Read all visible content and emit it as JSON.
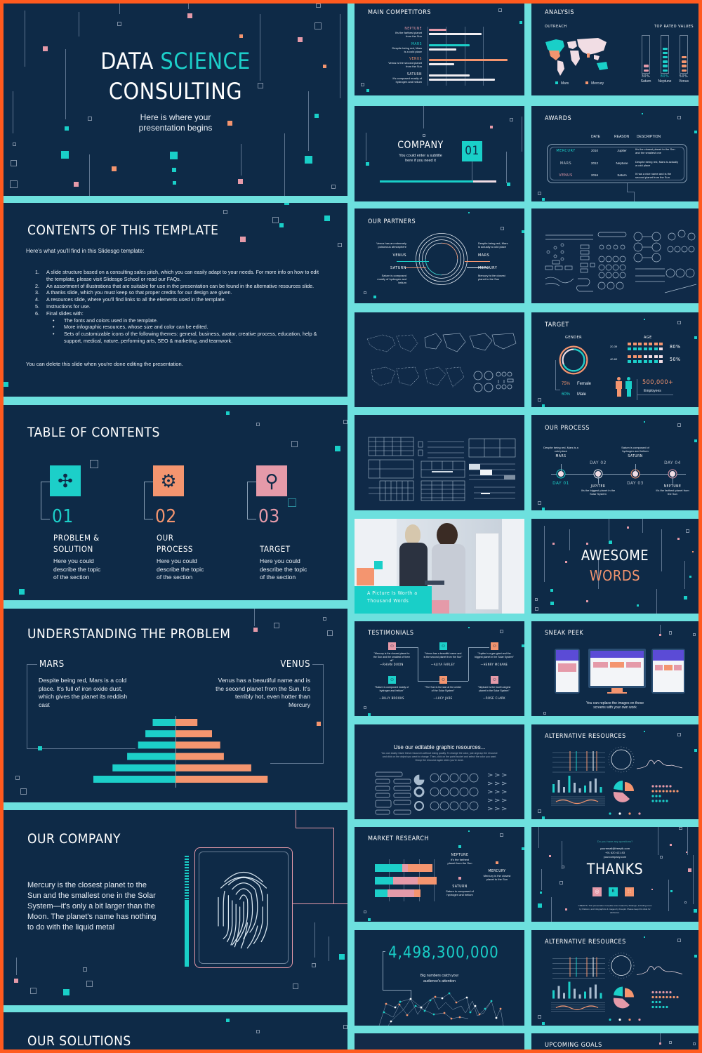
{
  "colors": {
    "border": "#ff5a1f",
    "gap": "#6de0de",
    "background": "#0e2a47",
    "teal": "#1ccfc9",
    "salmon": "#f4956f",
    "pink": "#e59aa9",
    "white": "#ffffff"
  },
  "left_slides": {
    "title": {
      "line1_a": "DATA",
      "line1_b": "SCIENCE",
      "line2": "CONSULTING",
      "subtitle_1": "Here is where your",
      "subtitle_2": "presentation begins"
    },
    "contents": {
      "title": "CONTENTS OF THIS TEMPLATE",
      "intro": "Here's what you'll find in this Slidesgo template:",
      "items": [
        {
          "num": "1.",
          "text": "A slide structure based on a consulting sales pitch, which you can easily adapt to your needs. For more info on how to edit the template, please visit Slidesgo School or read our FAQs."
        },
        {
          "num": "2.",
          "text": "An assortment of illustrations that are suitable for use in the presentation can be found in the alternative resources slide."
        },
        {
          "num": "3.",
          "text": "A thanks slide, which you must keep so that proper credits for our design are given."
        },
        {
          "num": "4.",
          "text": "A resources slide, where you'll find links to all the elements used in the template."
        },
        {
          "num": "5.",
          "text": "Instructions for use."
        },
        {
          "num": "6.",
          "text": "Final slides with:"
        }
      ],
      "bullets": [
        "The fonts and colors used in the template.",
        "More infographic resources, whose size and color can be edited.",
        "Sets of customizable icons of the following themes: general, business, avatar, creative process, education, help & support, medical, nature, performing arts, SEO & marketing, and teamwork."
      ],
      "footer": "You can delete this slide when you're done editing the presentation."
    },
    "toc": {
      "title": "TABLE OF CONTENTS",
      "sections": [
        {
          "num": "01",
          "title_1": "PROBLEM &",
          "title_2": "SOLUTION",
          "desc_1": "Here you could",
          "desc_2": "describe the topic",
          "desc_3": "of the section",
          "icon": "puzzle-icon"
        },
        {
          "num": "02",
          "title_1": "OUR",
          "title_2": "PROCESS",
          "desc_1": "Here you could",
          "desc_2": "describe the topic",
          "desc_3": "of the section",
          "icon": "gears-icon"
        },
        {
          "num": "03",
          "title_1": "",
          "title_2": "TARGET",
          "desc_1": "Here you could",
          "desc_2": "describe the topic",
          "desc_3": "of the section",
          "icon": "magnifier-user-icon"
        }
      ]
    },
    "problem": {
      "title": "UNDERSTANDING THE PROBLEM",
      "left_heading": "MARS",
      "left_text": "Despite being red, Mars is a cold place. It's full of iron oxide dust, which gives the planet its reddish cast",
      "right_heading": "VENUS",
      "right_text": "Venus has a beautiful name and is the second planet from the Sun. It's terribly hot, even hotter than Mercury",
      "pyramid": {
        "left": [
          0.25,
          0.33,
          0.41,
          0.53,
          0.69,
          0.9
        ],
        "right": [
          0.24,
          0.4,
          0.49,
          0.53,
          0.83,
          1.01
        ]
      }
    },
    "company": {
      "title": "OUR COMPANY",
      "text": "Mercury is the closest planet to the Sun and the smallest one in the Solar System—it's only a bit larger than the Moon. The planet's name has nothing to do with the liquid metal"
    },
    "solutions": {
      "title": "OUR SOLUTIONS"
    }
  },
  "right_slides": {
    "competitors": {
      "title": "MAIN COMPETITORS",
      "rows": [
        {
          "name": "NEPTUNE",
          "desc_1": "It's the farthest planet",
          "desc_2": "from the Sun",
          "color": "pink",
          "bar1": 0.22,
          "bar2": 0.67
        },
        {
          "name": "MARS",
          "desc_1": "Despite being red, Mars",
          "desc_2": "is a cold place",
          "color": "teal",
          "bar1": 0.52,
          "bar2": 0.35
        },
        {
          "name": "VENUS",
          "desc_1": "Venus is the second planet",
          "desc_2": "from the Sun",
          "color": "salmon",
          "bar1": 1.0,
          "bar2": 0.32
        },
        {
          "name": "SATURN",
          "desc_1": "It's composed mostly of",
          "desc_2": "hydrogen and helium",
          "color": "white",
          "bar1": 0.52,
          "bar2": 0.84
        }
      ]
    },
    "analysis": {
      "title": "ANALYSIS",
      "outreach_label": "OUTREACH",
      "top_rated_label": "TOP RATED VALUES",
      "legend": [
        "Mars",
        "Mercury"
      ],
      "values": [
        {
          "name": "Saturn",
          "pct": "30%",
          "fill": 0.3,
          "color": "pink"
        },
        {
          "name": "Neptune",
          "pct": "80%",
          "fill": 0.8,
          "color": "teal"
        },
        {
          "name": "Venus",
          "pct": "50%",
          "fill": 0.5,
          "color": "salmon"
        }
      ]
    },
    "company_section": {
      "title": "COMPANY",
      "subtitle_1": "You could enter a subtitle",
      "subtitle_2": "here if you need it",
      "number": "01",
      "progress": 0.8
    },
    "awards": {
      "title": "AWARDS",
      "headers": [
        "DATE",
        "REASON",
        "DESCRIPTION"
      ],
      "rows": [
        {
          "name": "MERCURY",
          "date": "2010",
          "reason": "Jupiter",
          "desc": "It's the closest planet to the Sun and the smallest one"
        },
        {
          "name": "MARS",
          "date": "2012",
          "reason": "Neptune",
          "desc": "Despite being red, Mars is actually a cold place"
        },
        {
          "name": "VENUS",
          "date": "2016",
          "reason": "Saturn",
          "desc": "It has a nice name and is the second planet from the Sun"
        }
      ]
    },
    "partners": {
      "title": "OUR PARTNERS",
      "left": [
        {
          "name": "VENUS",
          "desc": "Venus has an extremely poisonous atmosphere"
        },
        {
          "name": "SATURN",
          "desc": "Saturn is composed mostly of hydrogen and helium"
        }
      ],
      "right": [
        {
          "name": "MARS",
          "desc": "Despite being red, Mars is actually a cold place"
        },
        {
          "name": "MERCURY",
          "desc": "Mercury is the closest planet to the Sun"
        }
      ]
    },
    "target": {
      "title": "TARGET",
      "gender_label": "GENDER",
      "age_label": "AGE",
      "female_pct": "75%",
      "female_label": "Female",
      "male_pct": "60%",
      "male_label": "Male",
      "age_rows": [
        {
          "range": "20-39",
          "pct": "80%",
          "fill": 0.8
        },
        {
          "range": "40-60",
          "pct": "50%",
          "fill": 0.5
        }
      ],
      "employees_value": "500,000+",
      "employees_label": "Employees"
    },
    "process": {
      "title": "OUR PROCESS",
      "steps": [
        {
          "day": "DAY 01",
          "name": "MARS",
          "desc": "Despite being red, Mars is a cold place",
          "pos": "top",
          "color": "teal"
        },
        {
          "day": "DAY 02",
          "name": "JUPITER",
          "desc": "It's the biggest planet in the Solar System",
          "pos": "bottom",
          "color": "white"
        },
        {
          "day": "DAY 03",
          "name": "SATURN",
          "desc": "Saturn is composed of hydrogen and helium",
          "pos": "top",
          "color": "salmon"
        },
        {
          "day": "DAY 04",
          "name": "NEPTUNE",
          "desc": "It's the farthest planet from the Sun",
          "pos": "bottom",
          "color": "pink"
        }
      ]
    },
    "picture": {
      "caption_1": "A Picture Is Worth a",
      "caption_2": "Thousand Words"
    },
    "awesome": {
      "line1": "AWESOME",
      "line2": "WORDS"
    },
    "testimonials": {
      "title": "TESTIMONIALS",
      "items": [
        {
          "quote": "\"Mercury is the closest planet to the Sun and the smallest of them all\"",
          "author": "—RHIAN DIXON",
          "color": "pink"
        },
        {
          "quote": "\"Venus has a beautiful name and is the second planet from the Sun\"",
          "author": "—ALIYA FARLEY",
          "color": "teal"
        },
        {
          "quote": "\"Jupiter is a gas giant and the biggest planet in the Solar System\"",
          "author": "—HENRY MCKANE",
          "color": "salmon"
        },
        {
          "quote": "\"Saturn is composed mostly of hydrogen and helium\"",
          "author": "—BILLY BROOKS",
          "color": "teal"
        },
        {
          "quote": "\"The Sun is the star at the center of the Solar System\"",
          "author": "—LUCY JADE",
          "color": "salmon"
        },
        {
          "quote": "\"Neptune is the fourth-largest planet in the Solar System\"",
          "author": "—ROSE CLARK",
          "color": "pink"
        }
      ]
    },
    "sneak_peek": {
      "title": "SNEAK PEEK",
      "caption_1": "You can replace the images on these",
      "caption_2": "screens with your own work"
    },
    "editable": {
      "title": "Use our editable graphic resources...",
      "text": "You can easily resize these resources without losing quality. To change the color, just ungroup the resource and click on the object you want to change. Then, click on the paint bucket and select the color you want. Group the resource again when you're done."
    },
    "alt_resources_1": {
      "title": "ALTERNATIVE RESOURCES"
    },
    "market": {
      "title": "MARKET RESEARCH",
      "bars": [
        {
          "teal": 0.44,
          "pink": 0.09,
          "salmon": 0.4
        },
        {
          "teal": 0.29,
          "pink": 0.4,
          "salmon": 0.31
        },
        {
          "teal": 0.2,
          "pink": 0.44,
          "salmon": 0.1
        }
      ],
      "labels": [
        {
          "name": "NEPTUNE",
          "desc_1": "It's the farthest",
          "desc_2": "planet from the Sun",
          "color": "teal"
        },
        {
          "name": "MERCURY",
          "desc_1": "Mercury is the closest",
          "desc_2": "planet to the Sun",
          "color": "salmon"
        },
        {
          "name": "SATURN",
          "desc_1": "Saturn is composed of",
          "desc_2": "hydrogen and helium",
          "color": "pink"
        }
      ]
    },
    "thanks": {
      "question": "Do you have any questions?",
      "email": "youremail@freepik.com",
      "phone": "+91 620 421 83",
      "website": "yourcompany.com",
      "title": "THANKS",
      "credits": "CREDITS: This presentation template was created by Slidesgo, including icons by Flaticon, and infographics & images by Freepik. Please keep this slide for attribution."
    },
    "big_number": {
      "value": "4,498,300,000",
      "caption_1": "Big numbers catch your",
      "caption_2": "audience's attention"
    },
    "alt_resources_2": {
      "title": "ALTERNATIVE RESOURCES"
    },
    "upcoming": {
      "title": "UPCOMING GOALS"
    }
  }
}
